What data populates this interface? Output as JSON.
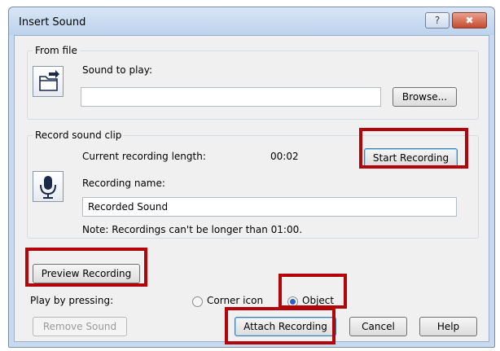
{
  "window": {
    "title": "Insert Sound",
    "help_glyph": "?",
    "close_glyph": "✖"
  },
  "from_file": {
    "legend": "From file",
    "sound_label": "Sound to play:",
    "sound_value": "",
    "browse_label": "Browse...",
    "icon": "open-folder-icon"
  },
  "record": {
    "legend": "Record sound clip",
    "length_label": "Current recording length:",
    "length_value": "00:02",
    "start_label": "Start Recording",
    "name_label": "Recording name:",
    "name_value": "Recorded Sound",
    "note": "Note: Recordings can't be longer than 01:00.",
    "icon": "microphone-icon"
  },
  "preview": {
    "label": "Preview Recording"
  },
  "play_by": {
    "label": "Play by pressing:",
    "options": [
      {
        "label": "Corner icon",
        "selected": false
      },
      {
        "label": "Object",
        "selected": true
      }
    ]
  },
  "footer": {
    "remove_label": "Remove Sound",
    "attach_label": "Attach Recording",
    "cancel_label": "Cancel",
    "help_label": "Help"
  },
  "colors": {
    "highlight": "#b3040a",
    "titlebar": "#c9daf0",
    "dialog_bg": "#f0f0f0",
    "radio_selected": "#2a63c4"
  }
}
